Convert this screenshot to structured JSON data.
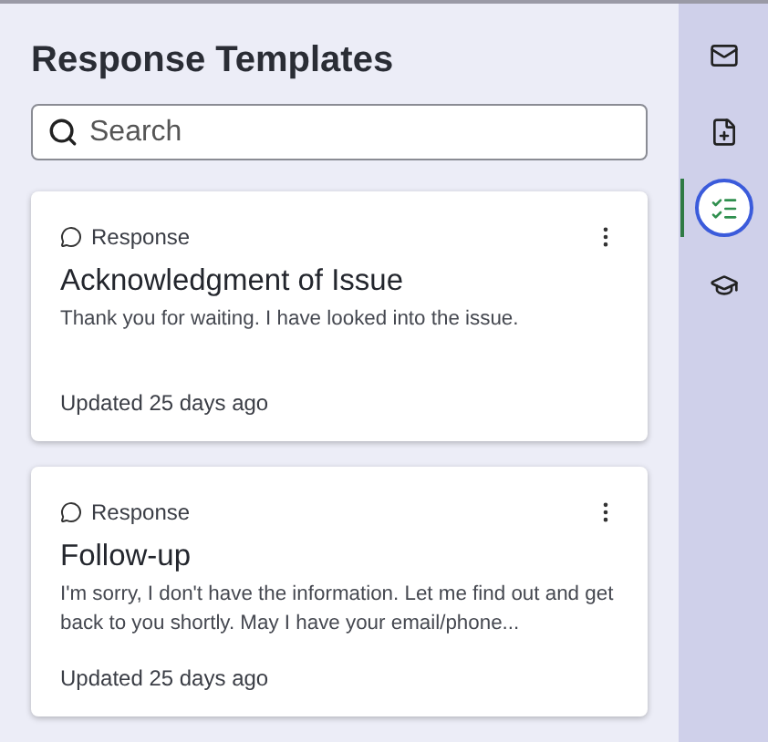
{
  "panel": {
    "title": "Response Templates",
    "search": {
      "placeholder": "Search"
    }
  },
  "templates": [
    {
      "type_label": "Response",
      "title": "Acknowledgment of Issue",
      "body": "Thank you for waiting. I have looked into the issue.",
      "updated": "Updated 25 days ago"
    },
    {
      "type_label": "Response",
      "title": "Follow-up",
      "body": "I'm sorry, I don't have the information. Let me find out and get back to you shortly. May I have your email/phone...",
      "updated": "Updated 25 days ago"
    }
  ],
  "sidebar": {
    "items": [
      {
        "kind": "mail",
        "selected": false
      },
      {
        "kind": "file",
        "selected": false
      },
      {
        "kind": "checklist",
        "selected": true
      },
      {
        "kind": "cap",
        "selected": false
      }
    ]
  }
}
